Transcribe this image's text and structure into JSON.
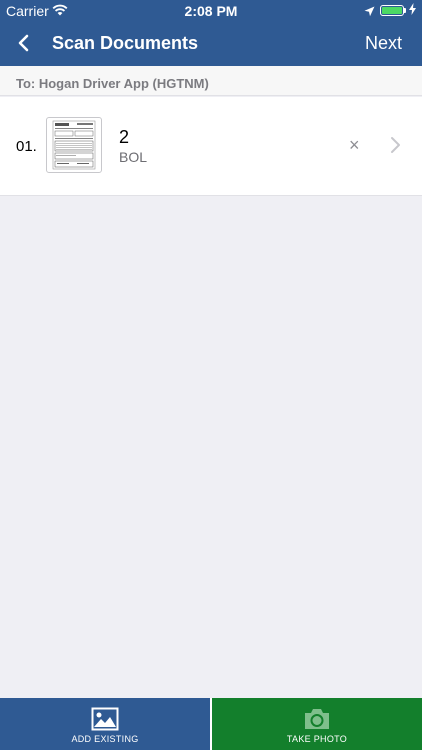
{
  "status_bar": {
    "carrier": "Carrier",
    "time": "2:08 PM"
  },
  "nav": {
    "title": "Scan Documents",
    "next_label": "Next"
  },
  "recipient": {
    "text": "To: Hogan Driver App (HGTNM)"
  },
  "documents": [
    {
      "index": "01.",
      "name": "2",
      "type": "BOL",
      "remove_symbol": "×"
    }
  ],
  "toolbar": {
    "add_existing_label": "ADD EXISTING",
    "take_photo_label": "TAKE PHOTO"
  },
  "colors": {
    "header": "#2f5a93",
    "take_photo": "#137f2c",
    "battery": "#4cd964",
    "background": "#efeff4"
  },
  "icons": {
    "wifi": "wifi-icon",
    "location": "location-arrow-icon",
    "battery": "battery-icon",
    "back": "chevron-left-icon",
    "remove": "close-icon",
    "disclosure": "chevron-right-icon",
    "gallery": "image-icon",
    "camera": "camera-icon"
  }
}
